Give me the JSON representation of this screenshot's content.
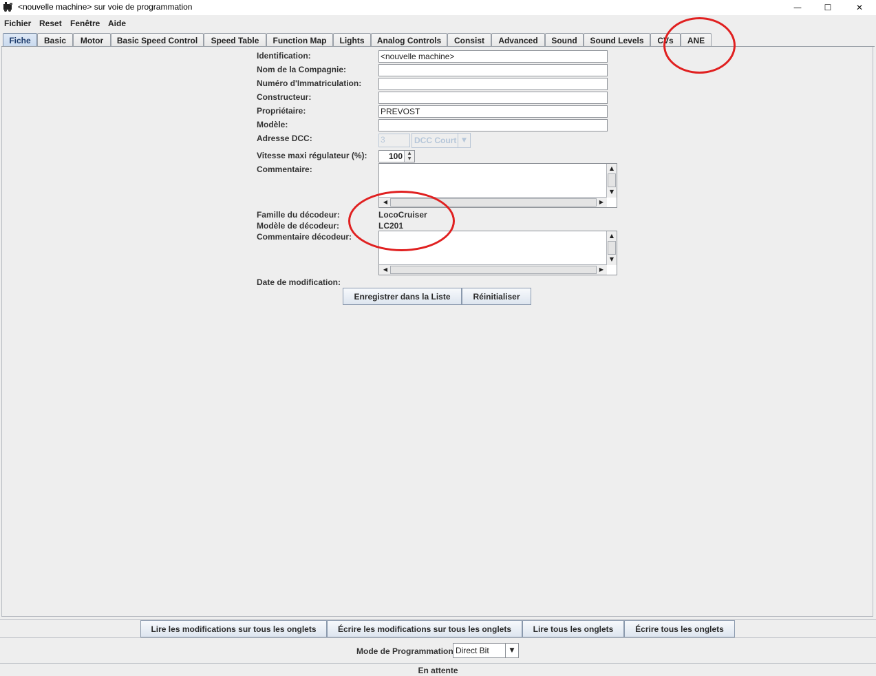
{
  "window": {
    "title": "<nouvelle machine> sur voie de programmation",
    "minimize_glyph": "—",
    "maximize_glyph": "☐",
    "close_glyph": "✕"
  },
  "menu": [
    "Fichier",
    "Reset",
    "Fenêtre",
    "Aide"
  ],
  "tabs": [
    "Fiche",
    "Basic",
    "Motor",
    "Basic Speed Control",
    "Speed Table",
    "Function Map",
    "Lights",
    "Analog Controls",
    "Consist",
    "Advanced",
    "Sound",
    "Sound Levels",
    "CVs",
    "ANE"
  ],
  "active_tab": "Fiche",
  "form": {
    "identification_label": "Identification:",
    "identification_value": "<nouvelle machine>",
    "company_label": "Nom de la Compagnie:",
    "company_value": "",
    "registration_label": "Numéro d'Immatriculation:",
    "registration_value": "",
    "builder_label": "Constructeur:",
    "builder_value": "",
    "owner_label": "Propriétaire:",
    "owner_value": "PREVOST",
    "model_label": "Modèle:",
    "model_value": "",
    "dcc_label": "Adresse DCC:",
    "dcc_value": "3",
    "dcc_mode": "DCC Court",
    "max_speed_label": "Vitesse maxi régulateur (%):",
    "max_speed_value": "100",
    "comment_label": "Commentaire:",
    "decoder_family_label": "Famille du décodeur:",
    "decoder_family_value": "LocoCruiser",
    "decoder_model_label": "Modèle de décodeur:",
    "decoder_model_value": "LC201",
    "decoder_comment_label": "Commentaire décodeur:",
    "date_label": "Date de modification:"
  },
  "buttons": {
    "save": "Enregistrer dans la Liste",
    "reset": "Réinitialiser",
    "read_changes": "Lire les modifications sur tous les onglets",
    "write_changes": "Écrire les modifications sur tous les onglets",
    "read_all": "Lire tous les onglets",
    "write_all": "Écrire tous les onglets"
  },
  "programming": {
    "label": "Mode de Programmation",
    "mode": "Direct Bit"
  },
  "status": "En attente",
  "colors": {
    "annotation": "#e02020",
    "active_tab": "#c8d9ee"
  },
  "annotations": [
    "red-circle-ane-tab",
    "red-circle-decoder-info"
  ]
}
